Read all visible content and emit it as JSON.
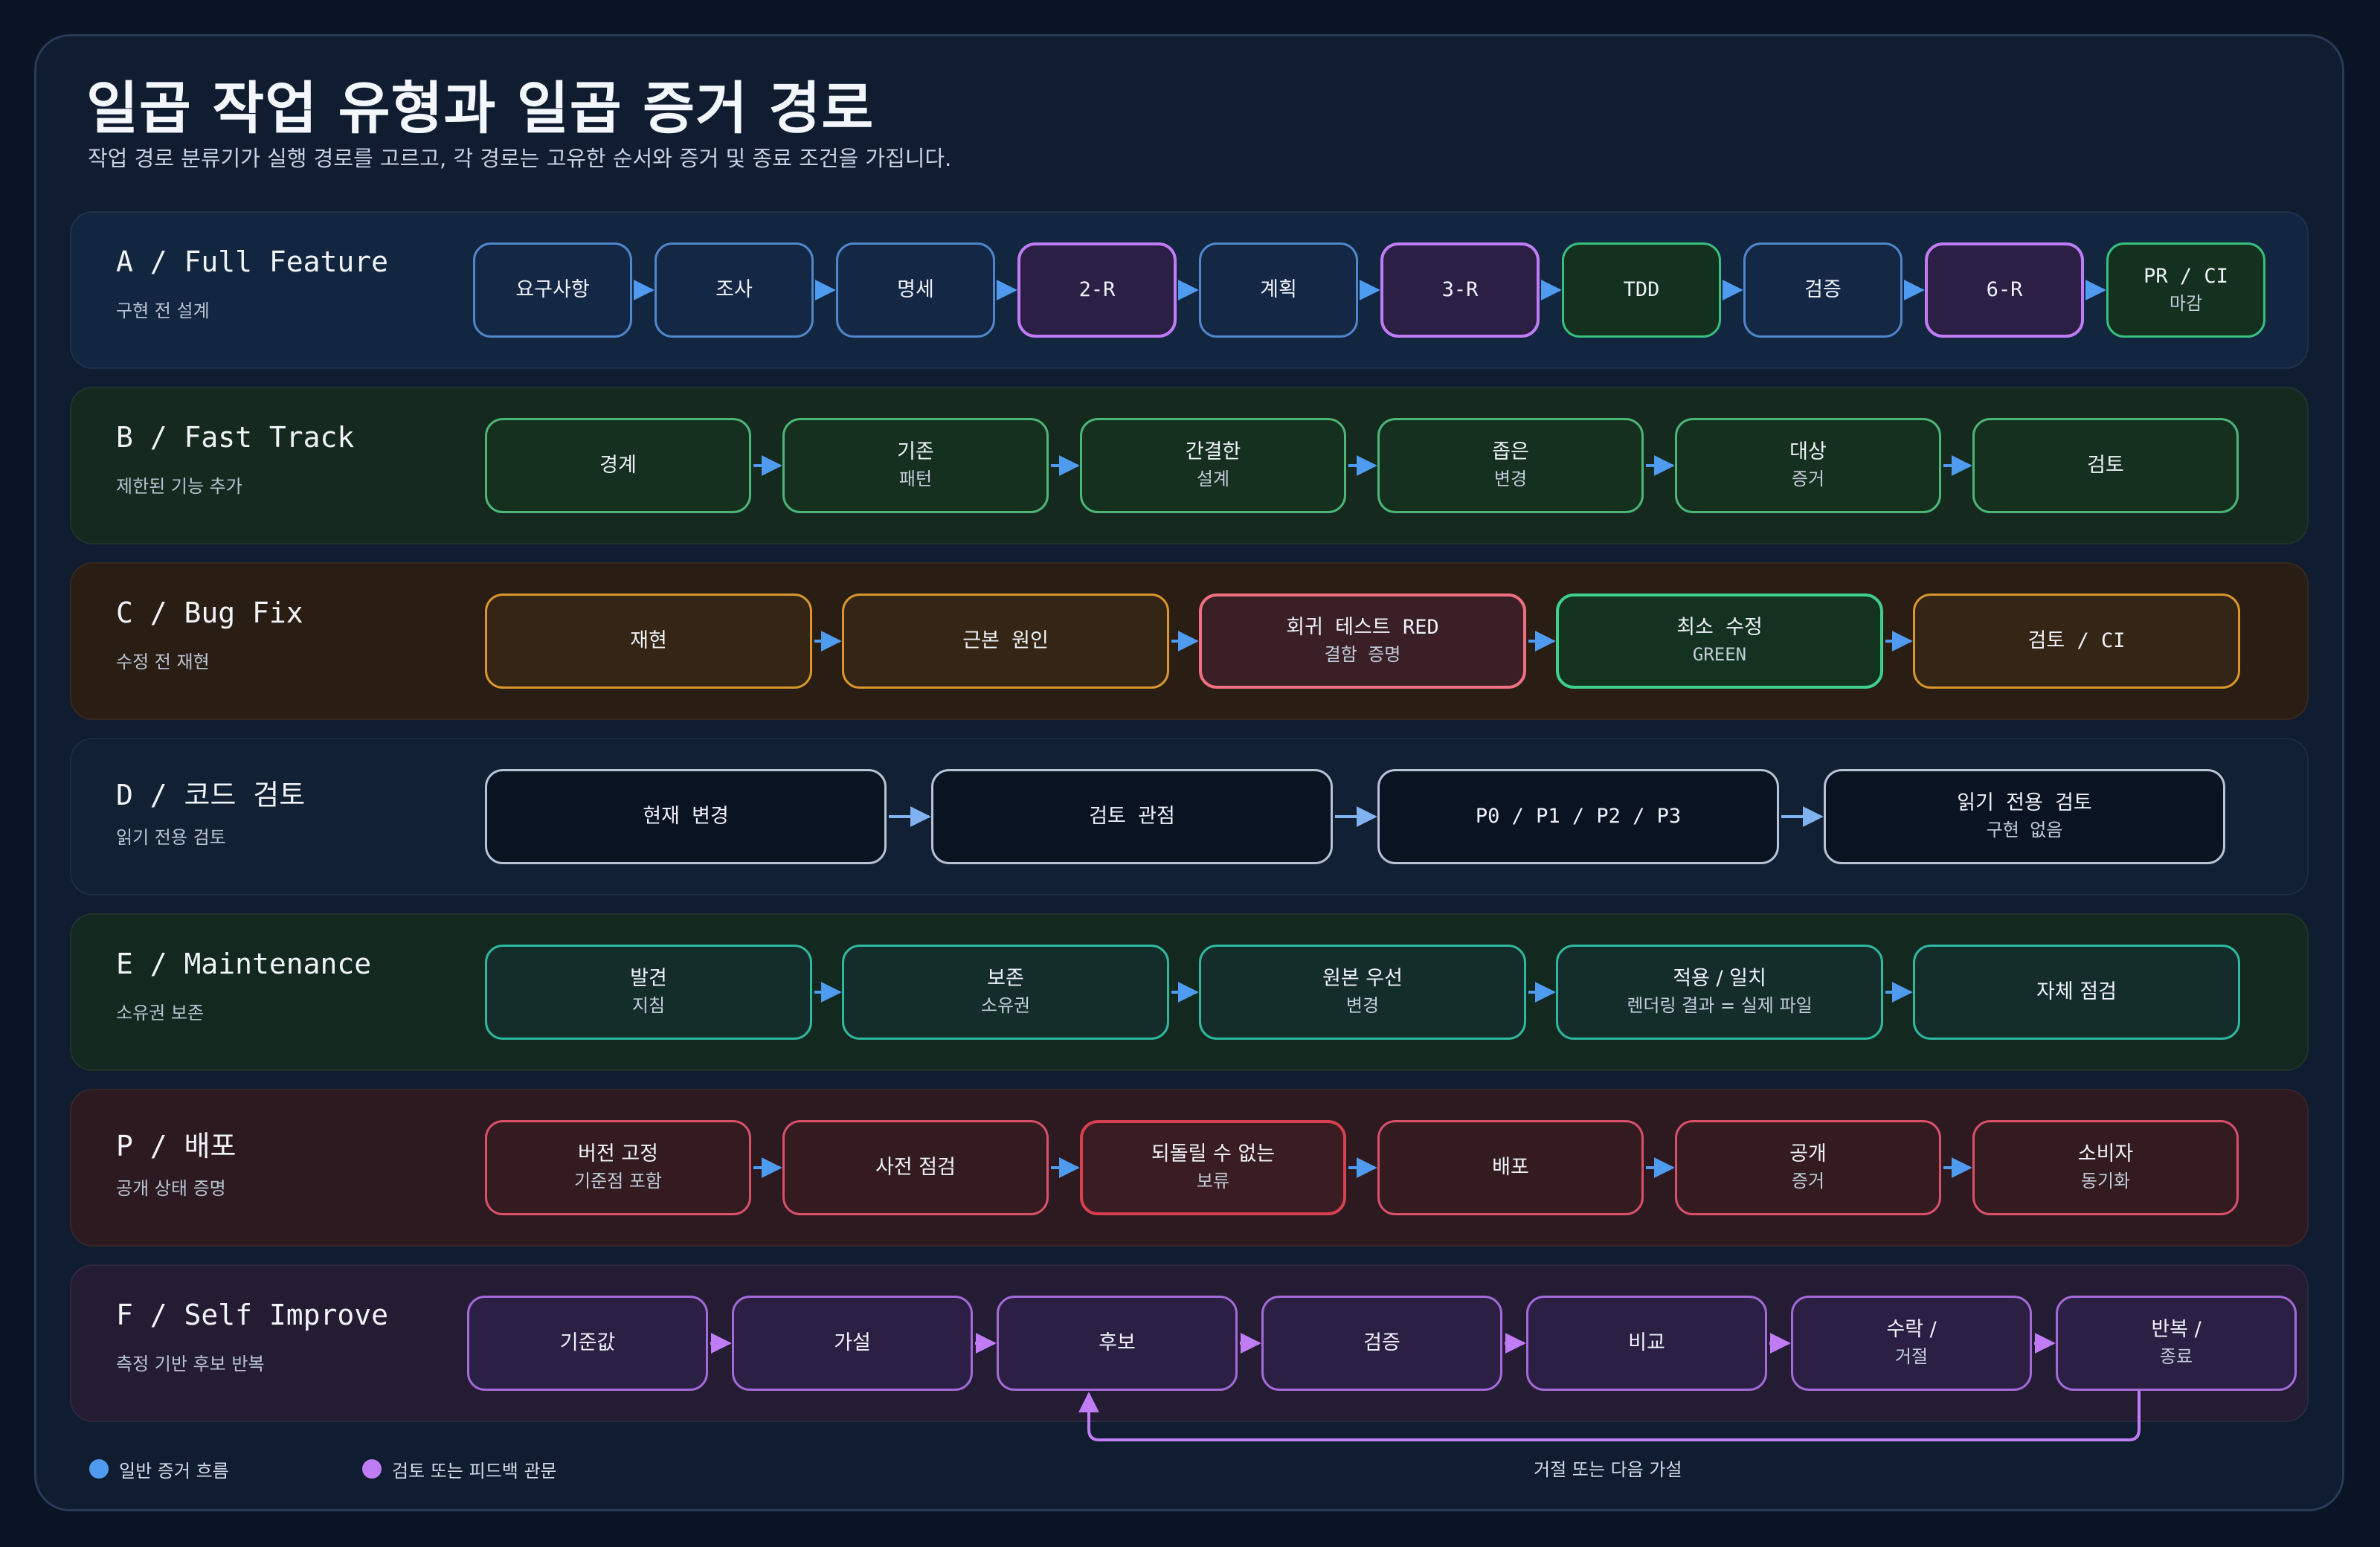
{
  "title": "일곱 작업 유형과 일곱 증거 경로",
  "subtitle": "작업 경로 분류기가 실행 경로를 고르고, 각 경로는 고유한 순서와 증거 및 종료 조건을 가집니다.",
  "colors": {
    "evidence_flow": "#4f9bf0",
    "review_gate": "#c07cf5"
  },
  "lanes": [
    {
      "id": "A",
      "title": "A / Full Feature",
      "subtitle": "구현 전 설계",
      "nodes": [
        {
          "label": "요구사항",
          "sub": "",
          "style": "blue"
        },
        {
          "label": "조사",
          "sub": "",
          "style": "blue"
        },
        {
          "label": "명세",
          "sub": "",
          "style": "blue"
        },
        {
          "label": "2-R",
          "sub": "",
          "style": "purple"
        },
        {
          "label": "계획",
          "sub": "",
          "style": "blue"
        },
        {
          "label": "3-R",
          "sub": "",
          "style": "purple"
        },
        {
          "label": "TDD",
          "sub": "",
          "style": "green"
        },
        {
          "label": "검증",
          "sub": "",
          "style": "blue"
        },
        {
          "label": "6-R",
          "sub": "",
          "style": "purple"
        },
        {
          "label": "PR / CI",
          "sub": "마감",
          "style": "green"
        }
      ]
    },
    {
      "id": "B",
      "title": "B / Fast Track",
      "subtitle": "제한된 기능 추가",
      "nodes": [
        {
          "label": "경계",
          "sub": "",
          "style": "fgreen"
        },
        {
          "label": "기존",
          "sub": "패턴",
          "style": "fgreen"
        },
        {
          "label": "간결한",
          "sub": "설계",
          "style": "fgreen"
        },
        {
          "label": "좁은",
          "sub": "변경",
          "style": "fgreen"
        },
        {
          "label": "대상",
          "sub": "증거",
          "style": "fgreen"
        },
        {
          "label": "검토",
          "sub": "",
          "style": "fgreen"
        }
      ]
    },
    {
      "id": "C",
      "title": "C / Bug Fix",
      "subtitle": "수정 전 재현",
      "nodes": [
        {
          "label": "재현",
          "sub": "",
          "style": "orange"
        },
        {
          "label": "근본 원인",
          "sub": "",
          "style": "orange"
        },
        {
          "label": "회귀 테스트 RED",
          "sub": "결함 증명",
          "style": "red"
        },
        {
          "label": "최소 수정",
          "sub": "GREEN",
          "style": "mint"
        },
        {
          "label": "검토 / CI",
          "sub": "",
          "style": "orange"
        }
      ]
    },
    {
      "id": "D",
      "title": "D / 코드 검토",
      "subtitle": "읽기 전용 검토",
      "nodes": [
        {
          "label": "현재 변경",
          "sub": "",
          "style": "navy"
        },
        {
          "label": "검토 관점",
          "sub": "",
          "style": "navy"
        },
        {
          "label": "P0 / P1 / P2 / P3",
          "sub": "",
          "style": "navy"
        },
        {
          "label": "읽기 전용 검토",
          "sub": "구현 없음",
          "style": "navy"
        }
      ]
    },
    {
      "id": "E",
      "title": "E / Maintenance",
      "subtitle": "소유권 보존",
      "nodes": [
        {
          "label": "발견",
          "sub": "지침",
          "style": "teal"
        },
        {
          "label": "보존",
          "sub": "소유권",
          "style": "teal"
        },
        {
          "label": "원본 우선",
          "sub": "변경",
          "style": "teal"
        },
        {
          "label": "적용 / 일치",
          "sub": "렌더링 결과 = 실제 파일",
          "style": "teal"
        },
        {
          "label": "자체 점검",
          "sub": "",
          "style": "teal"
        }
      ]
    },
    {
      "id": "P",
      "title": "P / 배포",
      "subtitle": "공개 상태 증명",
      "nodes": [
        {
          "label": "버전 고정",
          "sub": "기준점 포함",
          "style": "rose"
        },
        {
          "label": "사전 점검",
          "sub": "",
          "style": "rose"
        },
        {
          "label": "되돌릴 수 없는",
          "sub": "보류",
          "style": "rose2"
        },
        {
          "label": "배포",
          "sub": "",
          "style": "rose"
        },
        {
          "label": "공개",
          "sub": "증거",
          "style": "rose"
        },
        {
          "label": "소비자",
          "sub": "동기화",
          "style": "rose"
        }
      ]
    },
    {
      "id": "F",
      "title": "F / Self Improve",
      "subtitle": "측정 기반 후보 반복",
      "nodes": [
        {
          "label": "기준값",
          "sub": "",
          "style": "violet"
        },
        {
          "label": "가설",
          "sub": "",
          "style": "violet"
        },
        {
          "label": "후보",
          "sub": "",
          "style": "violet"
        },
        {
          "label": "검증",
          "sub": "",
          "style": "violet"
        },
        {
          "label": "비교",
          "sub": "",
          "style": "violet"
        },
        {
          "label": "수락 /",
          "sub": "거절",
          "style": "violet"
        },
        {
          "label": "반복 /",
          "sub": "종료",
          "style": "violet"
        }
      ],
      "loop_label": "거절 또는 다음 가설"
    }
  ],
  "legend": [
    {
      "label": "일반 증거 흐름",
      "color": "#4f9bf0"
    },
    {
      "label": "검토 또는 피드백 관문",
      "color": "#c07cf5"
    }
  ]
}
